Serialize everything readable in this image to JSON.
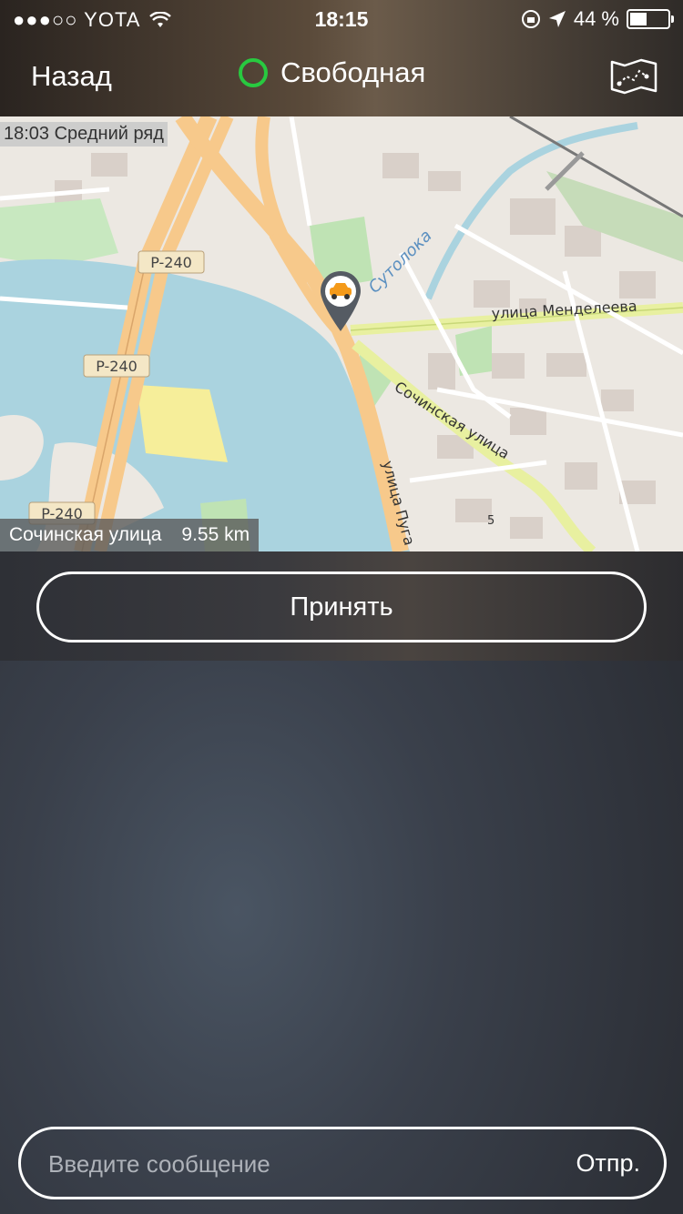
{
  "status_bar": {
    "signal": "●●●○○",
    "carrier": "YOTA",
    "time": "18:15",
    "battery_percent": "44 %",
    "battery_level": 0.44
  },
  "nav": {
    "back_label": "Назад",
    "title": "Свободная",
    "status_color": "#28c940"
  },
  "map": {
    "top_caption": "18:03 Средний ряд",
    "bottom_street": "Сочинская улица",
    "bottom_distance": "9.55 km",
    "road_labels": [
      "P-240",
      "P-240",
      "P-240"
    ],
    "street_labels": [
      "Сутолока",
      "улица Менделеева",
      "Сочинская улица",
      "улица Пуга",
      "5"
    ]
  },
  "accept_label": "Принять",
  "message": {
    "placeholder": "Введите сообщение",
    "send_label": "Отпр."
  }
}
